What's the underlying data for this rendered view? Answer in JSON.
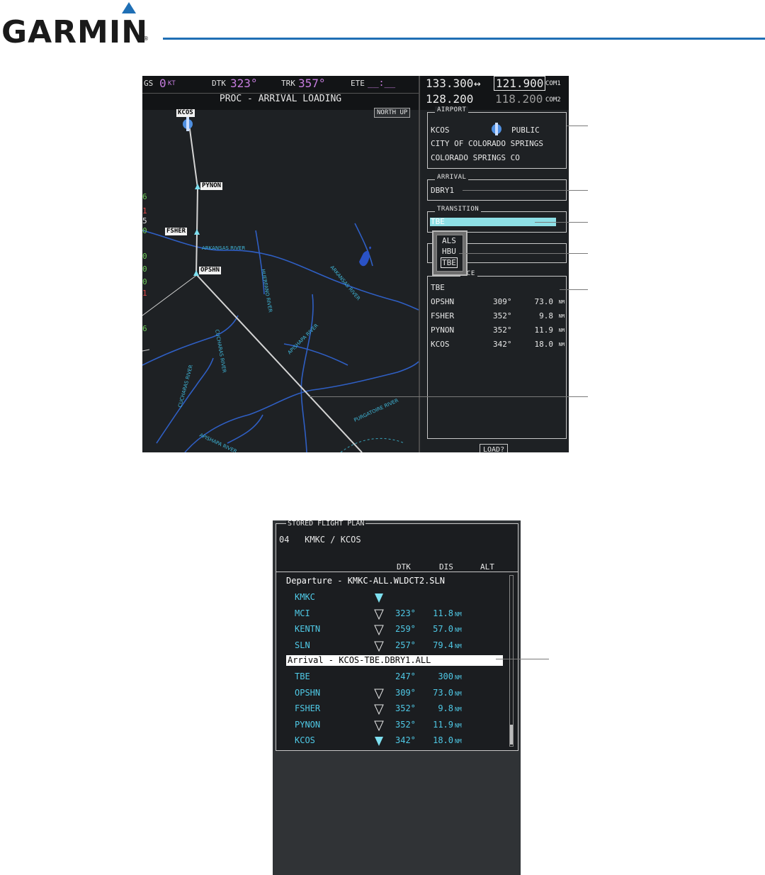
{
  "logo": {
    "text": "GARMIN",
    "reg": "®"
  },
  "mfd": {
    "nav_bar": {
      "gs_label": "GS",
      "gs_value": "0",
      "gs_unit": "KT",
      "dtk_label": "DTK",
      "dtk_value": "323°",
      "trk_label": "TRK",
      "trk_value": "357°",
      "ete_label": "ETE",
      "ete_value": "__:__"
    },
    "page_title": "PROC - ARRIVAL LOADING",
    "orientation": "NORTH UP",
    "com": {
      "com1_active": "133.300",
      "arrow": "↔",
      "com1_standby": "121.900",
      "com1_label": "COM1",
      "com2_active": "128.200",
      "com2_standby": "118.200",
      "com2_label": "COM2"
    },
    "map": {
      "waypoints": [
        "KCOS",
        "PYNON",
        "FSHER",
        "OPSHN"
      ],
      "rivers": [
        "ARKANSAS RIVER",
        "HUERFANO RIVER",
        "ARKANSAS RIVER",
        "APISHAPA RIVER",
        "CUCHARAS RIVER",
        "CUCHARAS RIVER",
        "PURGATOIRE RIVER",
        "APISHAPA RIVER"
      ]
    },
    "airport": {
      "title": "AIRPORT",
      "ident": "KCOS",
      "type": "PUBLIC",
      "city": "CITY OF COLORADO SPRINGS",
      "state": "COLORADO SPRINGS CO"
    },
    "arrival": {
      "title": "ARRIVAL",
      "value": "DBRY1"
    },
    "transition": {
      "title": "TRANSITION",
      "value": "TBE"
    },
    "transition_options": [
      "ALS",
      "HBU",
      "TBE"
    ],
    "sequence": {
      "title_tail": "ICE",
      "start": "TBE",
      "rows": [
        {
          "wpt": "OPSHN",
          "dtk": "309°",
          "dis": "73.0",
          "unit": "NM"
        },
        {
          "wpt": "FSHER",
          "dtk": "352°",
          "dis": "9.8",
          "unit": "NM"
        },
        {
          "wpt": "PYNON",
          "dtk": "352°",
          "dis": "11.9",
          "unit": "NM"
        },
        {
          "wpt": "KCOS",
          "dtk": "342°",
          "dis": "18.0",
          "unit": "NM"
        }
      ]
    },
    "load_button": "LOAD?"
  },
  "fpl": {
    "title": "STORED FLIGHT PLAN",
    "plan": "04   KMKC / KCOS",
    "headers": {
      "dtk": "DTK",
      "dis": "DIS",
      "alt": "ALT"
    },
    "departure": "Departure - KMKC-ALL.WLDCT2.SLN",
    "dep_rows": [
      {
        "wpt": "KMKC",
        "dtk": "",
        "dis": "",
        "unit": "",
        "active": true
      },
      {
        "wpt": "MCI",
        "dtk": "323°",
        "dis": "11.8",
        "unit": "NM",
        "active": false
      },
      {
        "wpt": "KENTN",
        "dtk": "259°",
        "dis": "57.0",
        "unit": "NM",
        "active": false
      },
      {
        "wpt": "SLN",
        "dtk": "257°",
        "dis": "79.4",
        "unit": "NM",
        "active": false
      }
    ],
    "arrival": "Arrival - KCOS-TBE.DBRY1.ALL",
    "arr_rows": [
      {
        "wpt": "TBE",
        "dtk": "247°",
        "dis": "300",
        "unit": "NM",
        "active": false,
        "nosym": true
      },
      {
        "wpt": "OPSHN",
        "dtk": "309°",
        "dis": "73.0",
        "unit": "NM",
        "active": false
      },
      {
        "wpt": "FSHER",
        "dtk": "352°",
        "dis": "9.8",
        "unit": "NM",
        "active": false
      },
      {
        "wpt": "PYNON",
        "dtk": "352°",
        "dis": "11.9",
        "unit": "NM",
        "active": false
      },
      {
        "wpt": "KCOS",
        "dtk": "342°",
        "dis": "18.0",
        "unit": "NM",
        "active": true
      }
    ]
  },
  "colors": {
    "brand": "#1f6fb5",
    "cyan": "#47c9e0",
    "magenta": "#c77de0"
  }
}
